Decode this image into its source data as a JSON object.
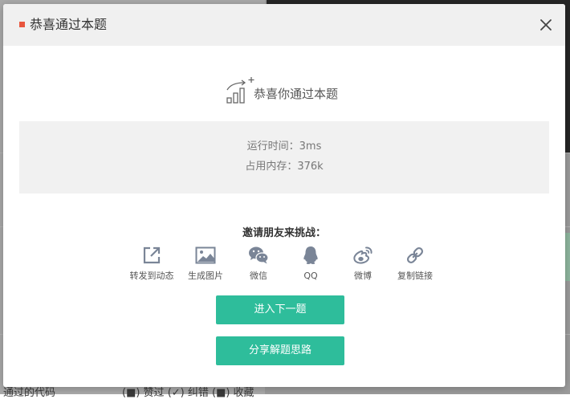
{
  "modal": {
    "title": "恭喜通过本题",
    "hero_text": "恭喜你通过本题",
    "stats": {
      "runtime": "运行时间：3ms",
      "memory": "占用内存：376k"
    },
    "invite_label": "邀请朋友来挑战：",
    "share_items": [
      {
        "label": "转发到动态",
        "icon": "share-external-icon"
      },
      {
        "label": "生成图片",
        "icon": "image-icon"
      },
      {
        "label": "微信",
        "icon": "wechat-icon"
      },
      {
        "label": "QQ",
        "icon": "qq-icon"
      },
      {
        "label": "微博",
        "icon": "weibo-icon"
      },
      {
        "label": "复制链接",
        "icon": "link-icon"
      }
    ],
    "next_button": "进入下一题",
    "share_solution_button": "分享解题思路"
  },
  "background": {
    "bottom_text": "通过的代码",
    "bottom_actions": "(■) 赞过  (✓) 纠错  (■) 收藏"
  },
  "colors": {
    "accent": "#2ebd9b",
    "title_dot": "#e8553e",
    "icon": "#7a8597"
  }
}
